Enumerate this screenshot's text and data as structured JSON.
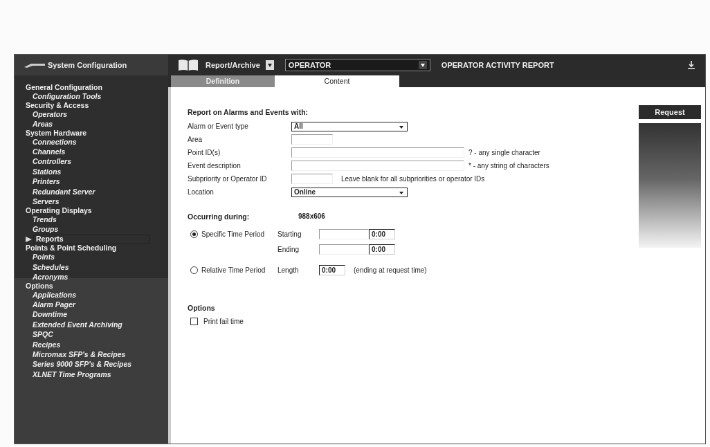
{
  "sidebar": {
    "title": "System Configuration",
    "groups": [
      {
        "label": "General Configuration",
        "children": [
          {
            "label": "Configuration Tools",
            "selected": false
          }
        ]
      },
      {
        "label": "Security & Access",
        "children": [
          {
            "label": "Operators",
            "selected": false
          },
          {
            "label": "Areas",
            "selected": false
          }
        ]
      },
      {
        "label": "System Hardware",
        "children": [
          {
            "label": "Connections",
            "selected": false
          },
          {
            "label": "Channels",
            "selected": false
          },
          {
            "label": "Controllers",
            "selected": false
          },
          {
            "label": "Stations",
            "selected": false
          },
          {
            "label": "Printers",
            "selected": false
          },
          {
            "label": "Redundant Server",
            "selected": false
          },
          {
            "label": "Servers",
            "selected": false
          }
        ]
      },
      {
        "label": "Operating Displays",
        "children": [
          {
            "label": "Trends",
            "selected": false
          },
          {
            "label": "Groups",
            "selected": false
          },
          {
            "label": "Reports",
            "selected": true
          }
        ]
      },
      {
        "label": "Points & Point Scheduling",
        "children": [
          {
            "label": "Points",
            "selected": false
          },
          {
            "label": "Schedules",
            "selected": false
          },
          {
            "label": "Acronyms",
            "selected": false
          }
        ]
      },
      {
        "label": "Options",
        "children": [
          {
            "label": "Applications",
            "selected": false
          },
          {
            "label": "Alarm Pager",
            "selected": false
          },
          {
            "label": "Downtime",
            "selected": false
          },
          {
            "label": "Extended Event Archiving",
            "selected": false
          },
          {
            "label": "SPQC",
            "selected": false
          },
          {
            "label": "Recipes",
            "selected": false
          },
          {
            "label": "Micromax SFP's & Recipes",
            "selected": false
          },
          {
            "label": "Series 9000 SFP's & Recipes",
            "selected": false
          },
          {
            "label": "XLNET Time Programs",
            "selected": false
          }
        ]
      }
    ]
  },
  "header": {
    "module": "Report/Archive",
    "operator": "OPERATOR",
    "report_title": "OPERATOR ACTIVITY REPORT"
  },
  "tabs": [
    {
      "label": "Definition",
      "selected": false
    },
    {
      "label": "Content",
      "selected": true
    }
  ],
  "form": {
    "heading": "Report on Alarms and Events with:",
    "fields": [
      {
        "kind": "select",
        "label": "Alarm or Event type",
        "value": "All"
      },
      {
        "kind": "short",
        "label": "Area"
      },
      {
        "kind": "text",
        "label": "Point ID(s)",
        "hint": "? - any single character"
      },
      {
        "kind": "text",
        "label": "Event description",
        "hint": "* - any string of characters"
      },
      {
        "kind": "short",
        "label": "Subpriority or Operator ID",
        "hint": "Leave blank for all subpriorities or operator IDs"
      },
      {
        "kind": "select",
        "label": "Location",
        "value": "Online"
      }
    ],
    "occurring": {
      "heading": "Occurring during:",
      "size_note": "988x606",
      "specific": {
        "label": "Specific Time Period",
        "selected": true,
        "starting": "Starting",
        "starting_time": "0:00",
        "ending": "Ending",
        "ending_time": "0:00"
      },
      "relative": {
        "label": "Relative Time Period",
        "selected": false,
        "length": "Length",
        "length_value": "0:00",
        "note": "(ending at request time)"
      }
    },
    "options": {
      "heading": "Options",
      "items": [
        {
          "label": "Print fail time",
          "checked": false
        }
      ]
    }
  },
  "request_button": "Request"
}
